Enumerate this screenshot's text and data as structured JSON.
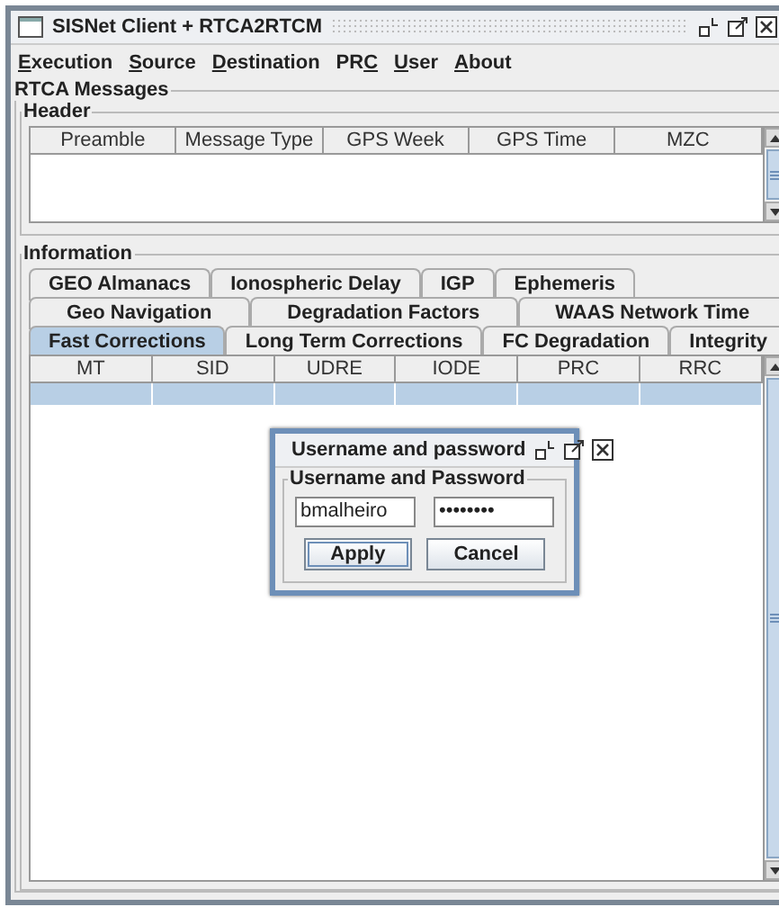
{
  "window": {
    "title": "SISNet Client + RTCA2RTCM"
  },
  "menu": [
    {
      "mnemonic": "E",
      "after": "xecution"
    },
    {
      "mnemonic": "S",
      "after": "ource"
    },
    {
      "mnemonic": "D",
      "after": "estination"
    },
    {
      "before": "PR",
      "mnemonic": "C"
    },
    {
      "mnemonic": "U",
      "after": "ser"
    },
    {
      "mnemonic": "A",
      "after": "bout"
    }
  ],
  "rtca_messages": {
    "title": "RTCA Messages",
    "header": {
      "title": "Header",
      "columns": [
        "Preamble",
        "Message Type",
        "GPS Week",
        "GPS Time",
        "MZC"
      ]
    },
    "information": {
      "title": "Information",
      "tab_rows": [
        [
          {
            "label": "GEO Almanacs",
            "selected": false
          },
          {
            "label": "Ionospheric Delay",
            "selected": false
          },
          {
            "label": "IGP",
            "selected": false
          },
          {
            "label": "Ephemeris",
            "selected": false
          }
        ],
        [
          {
            "label": "Geo Navigation",
            "selected": false
          },
          {
            "label": "Degradation Factors",
            "selected": false
          },
          {
            "label": "WAAS Network Time",
            "selected": false
          }
        ],
        [
          {
            "label": "Fast Corrections",
            "selected": true
          },
          {
            "label": "Long Term Corrections",
            "selected": false
          },
          {
            "label": "FC Degradation",
            "selected": false
          },
          {
            "label": "Integrity",
            "selected": false
          }
        ]
      ],
      "table": {
        "columns": [
          "MT",
          "SID",
          "UDRE",
          "IODE",
          "PRC",
          "RRC"
        ],
        "rows": [
          {
            "selected": true
          }
        ]
      }
    }
  },
  "dialog": {
    "title": "Username and password",
    "group": "Username and Password",
    "username": {
      "value": "bmalheiro"
    },
    "password": {
      "value": "••••••••"
    },
    "buttons": [
      {
        "label": "Apply",
        "focused": true
      },
      {
        "label": "Cancel",
        "focused": false
      }
    ]
  }
}
